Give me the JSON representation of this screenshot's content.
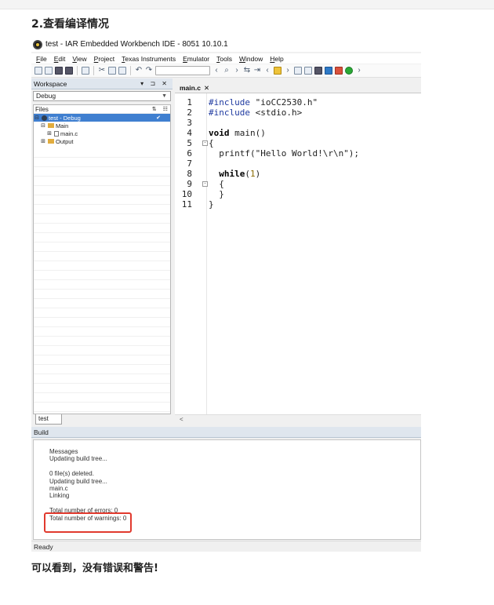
{
  "article": {
    "heading": "2.查看编译情况",
    "footer_text": "可以看到，没有错误和警告!"
  },
  "window": {
    "title": "test - IAR Embedded Workbench IDE - 8051 10.10.1"
  },
  "menu": [
    "File",
    "Edit",
    "View",
    "Project",
    "Texas Instruments",
    "Emulator",
    "Tools",
    "Window",
    "Help"
  ],
  "workspace": {
    "title": "Workspace",
    "controls": "▾ ⊐ ✕",
    "configuration": "Debug",
    "files_label": "Files",
    "tree": [
      {
        "label": "test - Debug",
        "mark": "✔"
      },
      {
        "label": "Main"
      },
      {
        "label": "main.c"
      },
      {
        "label": "Output"
      }
    ],
    "bottom_tab": "test"
  },
  "editor": {
    "tab_label": "main.c",
    "tab_close": "✕",
    "line_numbers": [
      "1",
      "2",
      "3",
      "4",
      "5",
      "6",
      "7",
      "8",
      "9",
      "10",
      "11"
    ],
    "scroll_arrow": "<"
  },
  "build": {
    "title": "Build",
    "messages": [
      "Messages",
      "Updating build tree...",
      "",
      "0 file(s) deleted.",
      "Updating build tree...",
      "main.c",
      "Linking",
      "",
      "Total number of errors: 0",
      "Total number of warnings: 0"
    ]
  },
  "status": {
    "text": "Ready"
  },
  "colors": {
    "selection": "#3f7fd0",
    "highlight_box": "#e13a2e",
    "panel_header": "#dfe6ee"
  },
  "icons": [
    "app-logo-icon",
    "new-file-icon",
    "open-icon",
    "save-icon",
    "save-all-icon",
    "print-icon",
    "cut-icon",
    "copy-icon",
    "paste-icon",
    "undo-icon",
    "redo-icon",
    "search-icon",
    "bookmark-icon",
    "make-icon",
    "debug-icon",
    "run-icon"
  ]
}
